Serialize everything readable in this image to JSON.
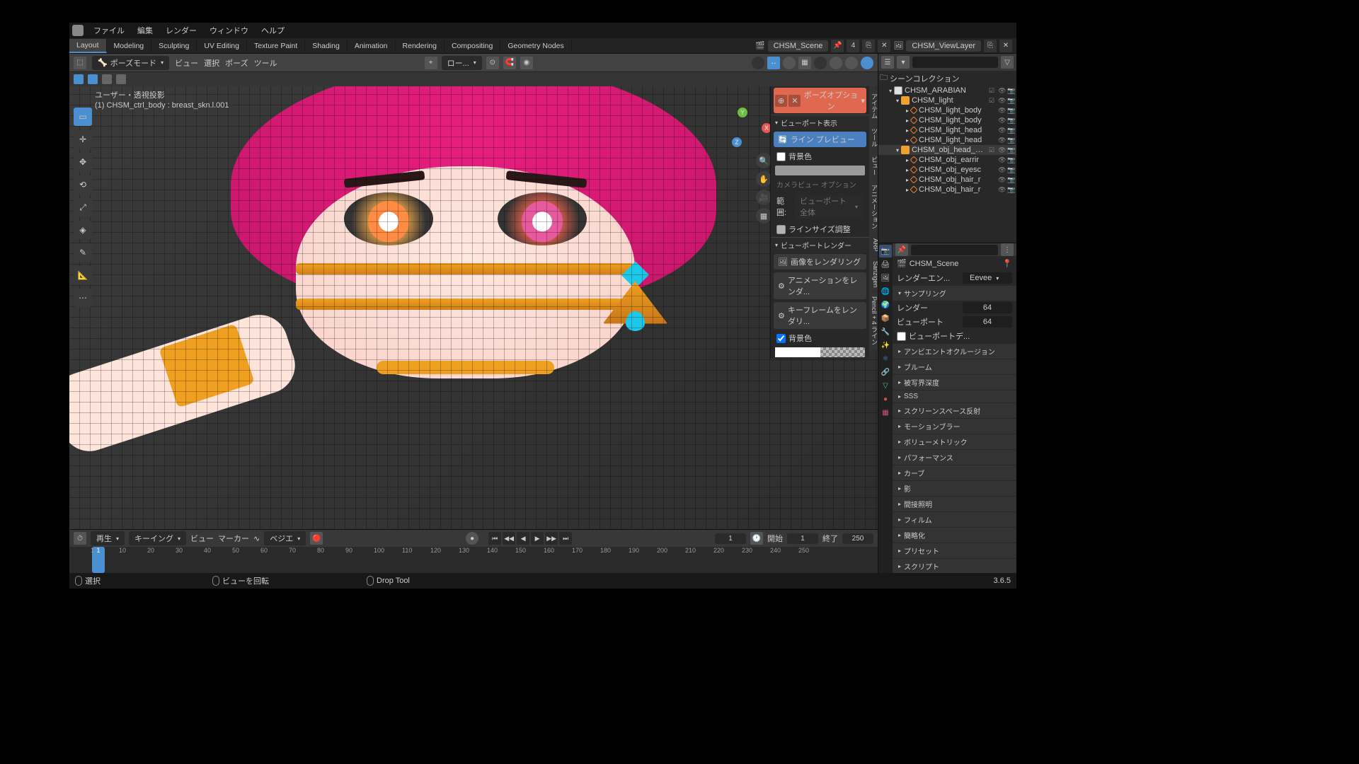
{
  "menu": [
    "ファイル",
    "編集",
    "レンダー",
    "ウィンドウ",
    "ヘルプ"
  ],
  "workspaces": [
    "Layout",
    "Modeling",
    "Sculpting",
    "UV Editing",
    "Texture Paint",
    "Shading",
    "Animation",
    "Rendering",
    "Compositing",
    "Geometry Nodes"
  ],
  "active_workspace": "Layout",
  "scene_name": "CHSM_Scene",
  "scene_count": "4",
  "viewlayer": "CHSM_ViewLayer",
  "viewport_header": {
    "mode": "ポーズモード",
    "menus": [
      "ビュー",
      "選択",
      "ポーズ",
      "ツール"
    ],
    "orient": "ロー..."
  },
  "overlay": {
    "l1": "ユーザー・透視投影",
    "l2": "(1) CHSM_ctrl_body : breast_skn.l.001"
  },
  "npanel": {
    "pill": "ポーズオプション",
    "h1": "ビューポート表示",
    "btn1": "ライン プレビュー",
    "bgcolor": "背景色",
    "cam_opt": "カメラビュー オプション",
    "range": "範囲:",
    "range_v": "ビューポート全体",
    "linesize": "ラインサイズ調整",
    "h2": "ビューポートレンダー",
    "r1": "画像をレンダリング",
    "r2": "アニメーションをレンダ...",
    "r3": "キーフレームをレンダリ...",
    "bgcolor2": "背景色",
    "tabs": [
      "アイテム",
      "ツール",
      "ビュー",
      "アニメーション",
      "ARP",
      "Sanzigen",
      "Pencil + 4 ライン"
    ]
  },
  "timeline": {
    "menus": [
      "再生",
      "キーイング",
      "ビュー",
      "マーカー"
    ],
    "bezier": "ベジエ",
    "current": "1",
    "start_lbl": "開始",
    "start": "1",
    "end_lbl": "終了",
    "end": "250",
    "ticks": [
      "1",
      "10",
      "20",
      "30",
      "40",
      "50",
      "60",
      "70",
      "80",
      "90",
      "100",
      "110",
      "120",
      "130",
      "140",
      "150",
      "160",
      "170",
      "180",
      "190",
      "200",
      "210",
      "220",
      "230",
      "240",
      "250"
    ]
  },
  "statusbar": {
    "select": "選択",
    "rotate": "ビューを回転",
    "drop": "Drop Tool",
    "version": "3.6.5"
  },
  "outliner": {
    "root": "シーンコレクション",
    "items": [
      {
        "ind": 10,
        "icon": "col",
        "label": "CHSM_ARABIAN",
        "chk": true
      },
      {
        "ind": 20,
        "icon": "box",
        "label": "CHSM_light",
        "chk": true
      },
      {
        "ind": 34,
        "icon": "mesh",
        "label": "CHSM_light_body"
      },
      {
        "ind": 34,
        "icon": "mesh",
        "label": "CHSM_light_body"
      },
      {
        "ind": 34,
        "icon": "mesh",
        "label": "CHSM_light_head"
      },
      {
        "ind": 34,
        "icon": "mesh",
        "label": "CHSM_light_head"
      },
      {
        "ind": 20,
        "icon": "box",
        "label": "CHSM_obj_head_acs",
        "chk": true,
        "sel": true
      },
      {
        "ind": 34,
        "icon": "mesh",
        "label": "CHSM_obj_earrir"
      },
      {
        "ind": 34,
        "icon": "mesh",
        "label": "CHSM_obj_eyesc"
      },
      {
        "ind": 34,
        "icon": "mesh",
        "label": "CHSM_obj_hair_r"
      },
      {
        "ind": 34,
        "icon": "mesh",
        "label": "CHSM_obj_hair_r"
      }
    ]
  },
  "props": {
    "scene": "CHSM_Scene",
    "engine_lbl": "レンダーエン...",
    "engine": "Eevee",
    "sampling": "サンプリング",
    "render_lbl": "レンダー",
    "render_v": "64",
    "viewport_lbl": "ビューポート",
    "viewport_v": "64",
    "vp_de": "ビューポートデ...",
    "sections": [
      "アンビエントオクルージョン",
      "ブルーム",
      "被写界深度",
      "SSS",
      "スクリーンスペース反射",
      "モーションブラー",
      "ボリューメトリック",
      "パフォーマンス",
      "カーブ",
      "影",
      "間接照明",
      "フィルム",
      "簡略化",
      "プリセット",
      "スクリプト"
    ]
  }
}
